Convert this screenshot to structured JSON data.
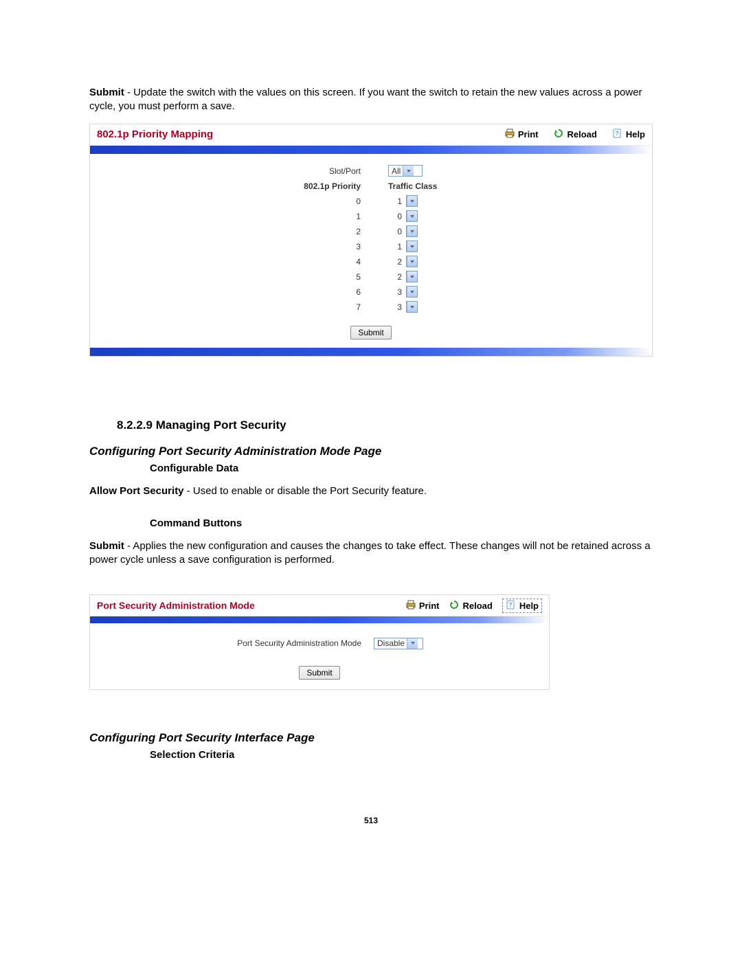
{
  "intro_text": {
    "bold": "Submit",
    "rest": " - Update the switch with the values on this screen. If you want the switch to retain the new values across a power cycle, you must perform a save."
  },
  "toolbar": {
    "print_label": "Print",
    "reload_label": "Reload",
    "help_label": "Help"
  },
  "panel1": {
    "title": "802.1p Priority Mapping",
    "slot_port_label": "Slot/Port",
    "slot_port_value": "All",
    "col_priority": "802.1p Priority",
    "col_traffic": "Traffic Class",
    "rows": [
      {
        "priority": "0",
        "traffic": "1"
      },
      {
        "priority": "1",
        "traffic": "0"
      },
      {
        "priority": "2",
        "traffic": "0"
      },
      {
        "priority": "3",
        "traffic": "1"
      },
      {
        "priority": "4",
        "traffic": "2"
      },
      {
        "priority": "5",
        "traffic": "2"
      },
      {
        "priority": "6",
        "traffic": "3"
      },
      {
        "priority": "7",
        "traffic": "3"
      }
    ],
    "submit": "Submit"
  },
  "section": {
    "num_title": "8.2.2.9 Managing Port Security",
    "h4a": "Configuring Port Security Administration Mode Page",
    "sub1": "Configurable Data",
    "allow_bold": "Allow Port Security",
    "allow_rest": " - Used to enable or disable the Port Security feature.",
    "sub2": "Command Buttons",
    "submit_bold": "Submit",
    "submit_rest": " - Applies the new configuration and causes the changes to take effect. These changes will not be retained across a power cycle unless a save configuration is performed.",
    "h4b": "Configuring Port Security Interface Page",
    "sub3": "Selection Criteria"
  },
  "panel2": {
    "title": "Port Security Administration Mode",
    "label": "Port Security Administration Mode",
    "value": "Disable",
    "submit": "Submit"
  },
  "page_number": "513"
}
